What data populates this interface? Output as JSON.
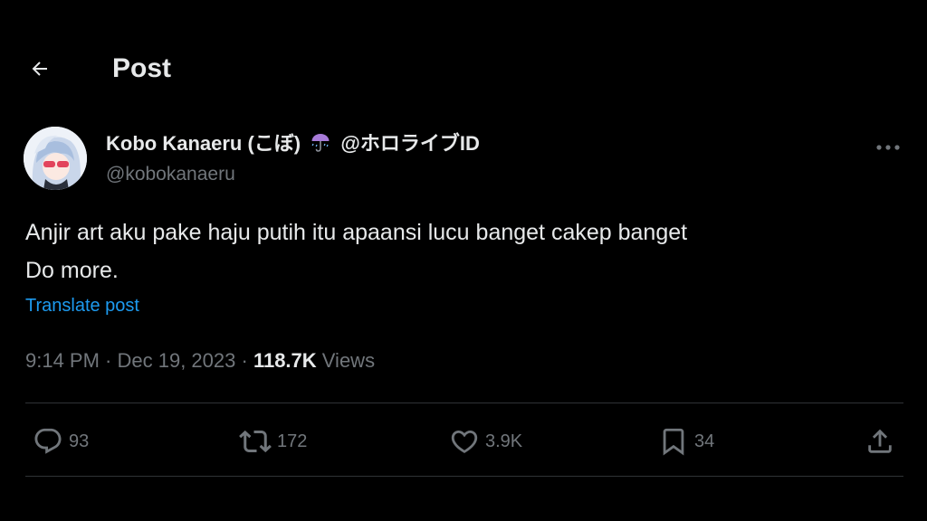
{
  "header": {
    "title": "Post",
    "back_icon": "arrow-left-icon"
  },
  "author": {
    "display_name": "Kobo Kanaeru (こぼ)",
    "affiliation": "@ホロライブID",
    "emoji_icon": "umbrella-with-rain-icon",
    "handle": "@kobokanaeru",
    "more_icon": "more-horizontal-icon"
  },
  "tweet": {
    "lines": [
      "Anjir art aku pake haju putih itu apaansi lucu banget cakep banget",
      "Do more."
    ],
    "translate_label": "Translate post"
  },
  "meta": {
    "time": "9:14 PM",
    "separator": " · ",
    "date": "Dec 19, 2023",
    "views_count": "118.7K",
    "views_label": " Views"
  },
  "actions": {
    "replies": "93",
    "reposts": "172",
    "likes": "3.9K",
    "bookmarks": "34"
  },
  "colors": {
    "background": "#000000",
    "text_primary": "#e7e9ea",
    "text_secondary": "#71767b",
    "accent": "#1d9bf0",
    "divider": "#2f3336"
  }
}
